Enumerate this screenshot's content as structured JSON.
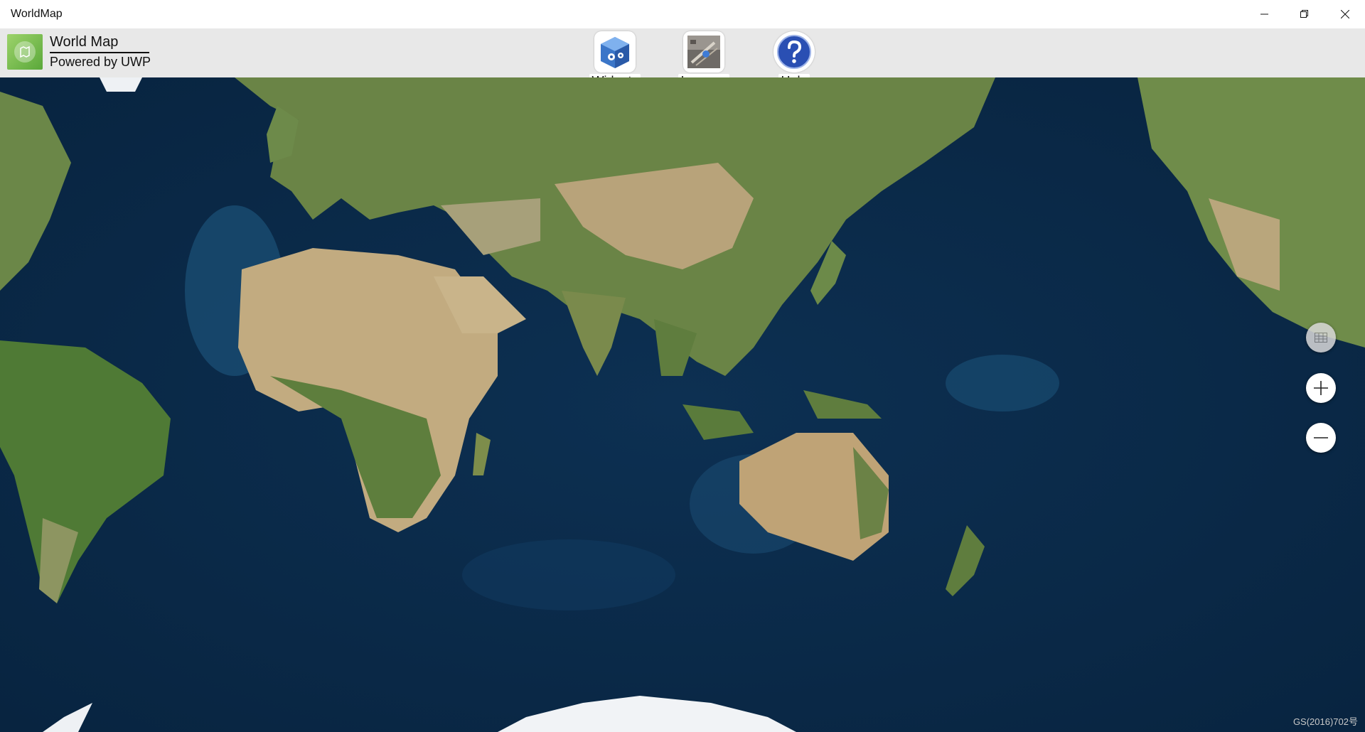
{
  "window": {
    "title": "WorldMap",
    "controls": [
      "minimize-icon",
      "restore-icon",
      "close-icon"
    ]
  },
  "header": {
    "app_name": "World Map",
    "subtitle": "Powered by UWP",
    "tools": [
      {
        "label": "Widgets",
        "icon": "widgets-icon"
      },
      {
        "label": "Imagery",
        "icon": "imagery-icon"
      },
      {
        "label": "Help",
        "icon": "help-icon"
      }
    ]
  },
  "map": {
    "controls": [
      "grid-icon",
      "zoom-in-icon",
      "zoom-out-icon"
    ],
    "credit": "GS(2016)702号",
    "colors": {
      "ocean": "#0b2a47",
      "shelf": "#1f5a84",
      "land": "#6f8b4a",
      "desert": "#c9b48a",
      "ice": "#f2f4f6"
    }
  }
}
